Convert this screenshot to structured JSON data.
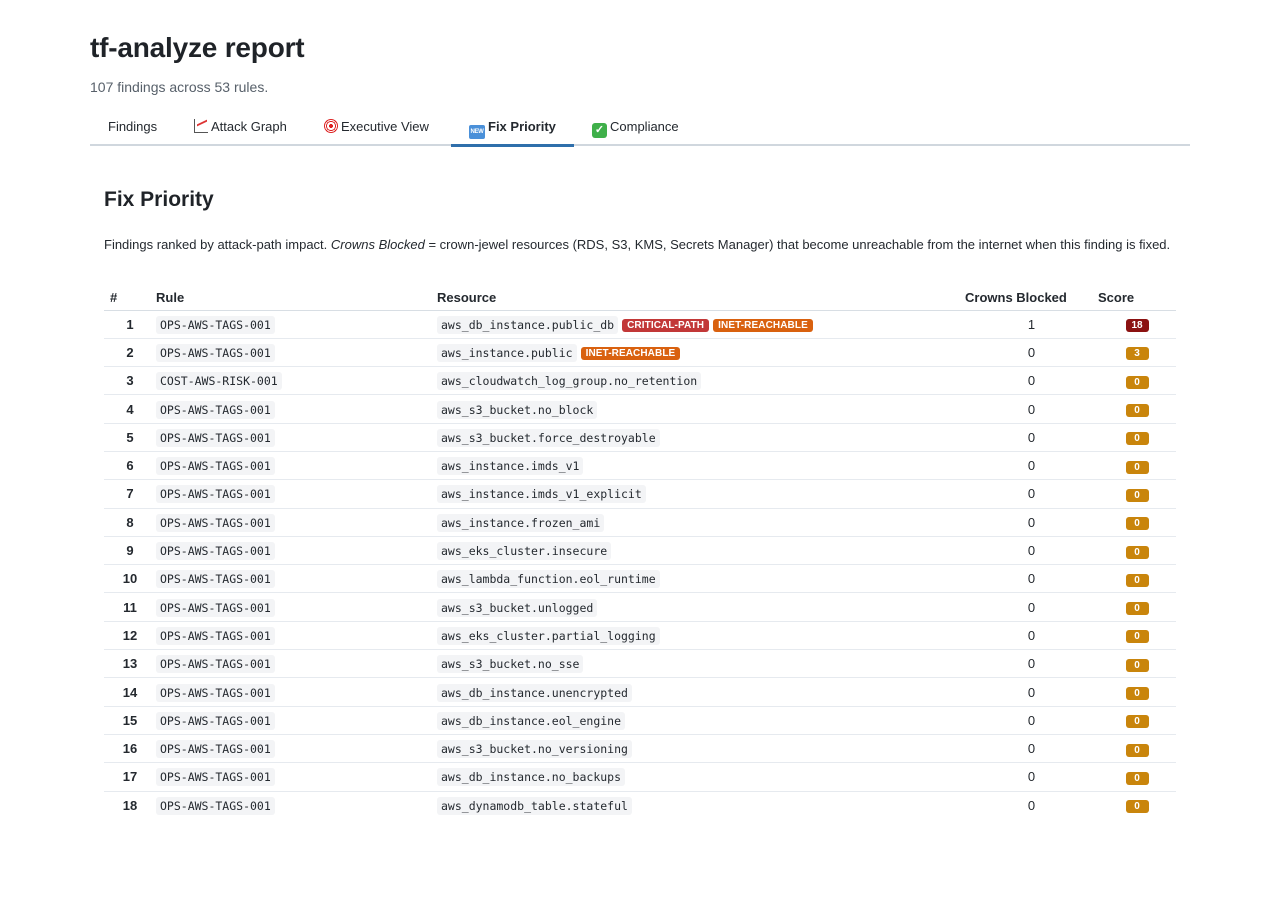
{
  "page": {
    "title": "tf-analyze report",
    "subtitle": "107 findings across 53 rules."
  },
  "tabs": [
    {
      "label": "Findings",
      "icon": ""
    },
    {
      "label": "Attack Graph",
      "icon": "chart-increasing-icon"
    },
    {
      "label": "Executive View",
      "icon": "target-icon"
    },
    {
      "label": "Fix Priority",
      "icon": "new-icon",
      "active": true
    },
    {
      "label": "Compliance",
      "icon": "check-mark-icon"
    }
  ],
  "panel": {
    "title": "Fix Priority",
    "desc_prefix": "Findings ranked by attack-path impact. ",
    "desc_em": "Crowns Blocked",
    "desc_suffix": " = crown-jewel resources (RDS, S3, KMS, Secrets Manager) that become unreachable from the internet when this finding is fixed."
  },
  "table": {
    "headers": {
      "num": "#",
      "rule": "Rule",
      "resource": "Resource",
      "crowns": "Crowns Blocked",
      "score": "Score"
    },
    "rows": [
      {
        "num": "1",
        "rule": "OPS-AWS-TAGS-001",
        "resource": "aws_db_instance.public_db",
        "badges": [
          "CRITICAL-PATH",
          "INET-REACHABLE"
        ],
        "crowns": "1",
        "score": "18"
      },
      {
        "num": "2",
        "rule": "OPS-AWS-TAGS-001",
        "resource": "aws_instance.public",
        "badges": [
          "INET-REACHABLE"
        ],
        "crowns": "0",
        "score": "3"
      },
      {
        "num": "3",
        "rule": "COST-AWS-RISK-001",
        "resource": "aws_cloudwatch_log_group.no_retention",
        "badges": [],
        "crowns": "0",
        "score": "0"
      },
      {
        "num": "4",
        "rule": "OPS-AWS-TAGS-001",
        "resource": "aws_s3_bucket.no_block",
        "badges": [],
        "crowns": "0",
        "score": "0"
      },
      {
        "num": "5",
        "rule": "OPS-AWS-TAGS-001",
        "resource": "aws_s3_bucket.force_destroyable",
        "badges": [],
        "crowns": "0",
        "score": "0"
      },
      {
        "num": "6",
        "rule": "OPS-AWS-TAGS-001",
        "resource": "aws_instance.imds_v1",
        "badges": [],
        "crowns": "0",
        "score": "0"
      },
      {
        "num": "7",
        "rule": "OPS-AWS-TAGS-001",
        "resource": "aws_instance.imds_v1_explicit",
        "badges": [],
        "crowns": "0",
        "score": "0"
      },
      {
        "num": "8",
        "rule": "OPS-AWS-TAGS-001",
        "resource": "aws_instance.frozen_ami",
        "badges": [],
        "crowns": "0",
        "score": "0"
      },
      {
        "num": "9",
        "rule": "OPS-AWS-TAGS-001",
        "resource": "aws_eks_cluster.insecure",
        "badges": [],
        "crowns": "0",
        "score": "0"
      },
      {
        "num": "10",
        "rule": "OPS-AWS-TAGS-001",
        "resource": "aws_lambda_function.eol_runtime",
        "badges": [],
        "crowns": "0",
        "score": "0"
      },
      {
        "num": "11",
        "rule": "OPS-AWS-TAGS-001",
        "resource": "aws_s3_bucket.unlogged",
        "badges": [],
        "crowns": "0",
        "score": "0"
      },
      {
        "num": "12",
        "rule": "OPS-AWS-TAGS-001",
        "resource": "aws_eks_cluster.partial_logging",
        "badges": [],
        "crowns": "0",
        "score": "0"
      },
      {
        "num": "13",
        "rule": "OPS-AWS-TAGS-001",
        "resource": "aws_s3_bucket.no_sse",
        "badges": [],
        "crowns": "0",
        "score": "0"
      },
      {
        "num": "14",
        "rule": "OPS-AWS-TAGS-001",
        "resource": "aws_db_instance.unencrypted",
        "badges": [],
        "crowns": "0",
        "score": "0"
      },
      {
        "num": "15",
        "rule": "OPS-AWS-TAGS-001",
        "resource": "aws_db_instance.eol_engine",
        "badges": [],
        "crowns": "0",
        "score": "0"
      },
      {
        "num": "16",
        "rule": "OPS-AWS-TAGS-001",
        "resource": "aws_s3_bucket.no_versioning",
        "badges": [],
        "crowns": "0",
        "score": "0"
      },
      {
        "num": "17",
        "rule": "OPS-AWS-TAGS-001",
        "resource": "aws_db_instance.no_backups",
        "badges": [],
        "crowns": "0",
        "score": "0"
      },
      {
        "num": "18",
        "rule": "OPS-AWS-TAGS-001",
        "resource": "aws_dynamodb_table.stateful",
        "badges": [],
        "crowns": "0",
        "score": "0"
      }
    ]
  },
  "colors": {
    "accent": "#2f6fab",
    "critical_badge": "#c23838",
    "inet_badge": "#d9610f",
    "score_high": "#8b1111",
    "score_low": "#c9850c"
  }
}
